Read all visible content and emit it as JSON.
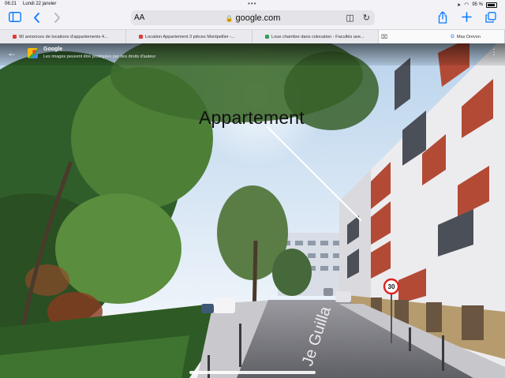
{
  "status": {
    "time": "06:21",
    "date": "Lundi 22 janvier",
    "battery": "95 %"
  },
  "toolbar": {
    "text_size": "AA",
    "url": "google.com"
  },
  "tabs": [
    {
      "label": "90 annonces de locations d'appartements 4...",
      "favicon_color": "#e03b3b"
    },
    {
      "label": "Location Appartement 3 pièces Montpellier -...",
      "favicon_color": "#e03b3b"
    },
    {
      "label": "Loue chambre dans colocation - Facultés ave...",
      "favicon_color": "#3a9a5b"
    },
    {
      "label": "Mas Drevon",
      "favicon_color": "#4285f4"
    }
  ],
  "streetview": {
    "title": "Google",
    "subtitle": "Les images peuvent être protégées par des droits d'auteur",
    "annotation": "Appartement",
    "road_sign": "30",
    "street_text": "Je Guilla"
  }
}
